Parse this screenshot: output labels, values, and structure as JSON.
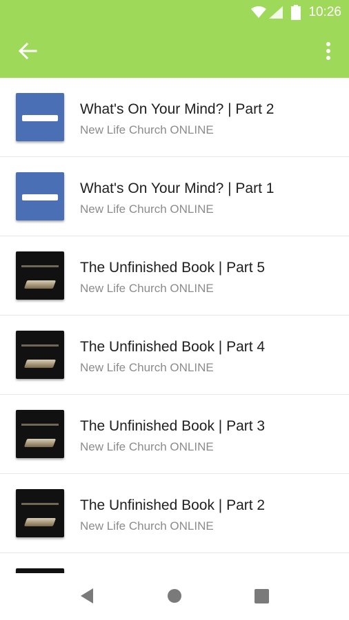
{
  "status_bar": {
    "time": "10:26"
  },
  "episodes": [
    {
      "title": "What's On Your Mind? | Part 2",
      "subtitle": "New Life Church ONLINE",
      "thumb": "blue"
    },
    {
      "title": "What's On Your Mind? | Part 1",
      "subtitle": "New Life Church ONLINE",
      "thumb": "blue"
    },
    {
      "title": "The Unfinished Book | Part 5",
      "subtitle": "New Life Church ONLINE",
      "thumb": "dark"
    },
    {
      "title": "The Unfinished Book | Part 4",
      "subtitle": "New Life Church ONLINE",
      "thumb": "dark"
    },
    {
      "title": "The Unfinished Book | Part 3",
      "subtitle": "New Life Church ONLINE",
      "thumb": "dark"
    },
    {
      "title": "The Unfinished Book | Part 2",
      "subtitle": "New Life Church ONLINE",
      "thumb": "dark"
    },
    {
      "title": "",
      "subtitle": "",
      "thumb": "dark"
    }
  ],
  "colors": {
    "appbar": "#9ed95a"
  }
}
